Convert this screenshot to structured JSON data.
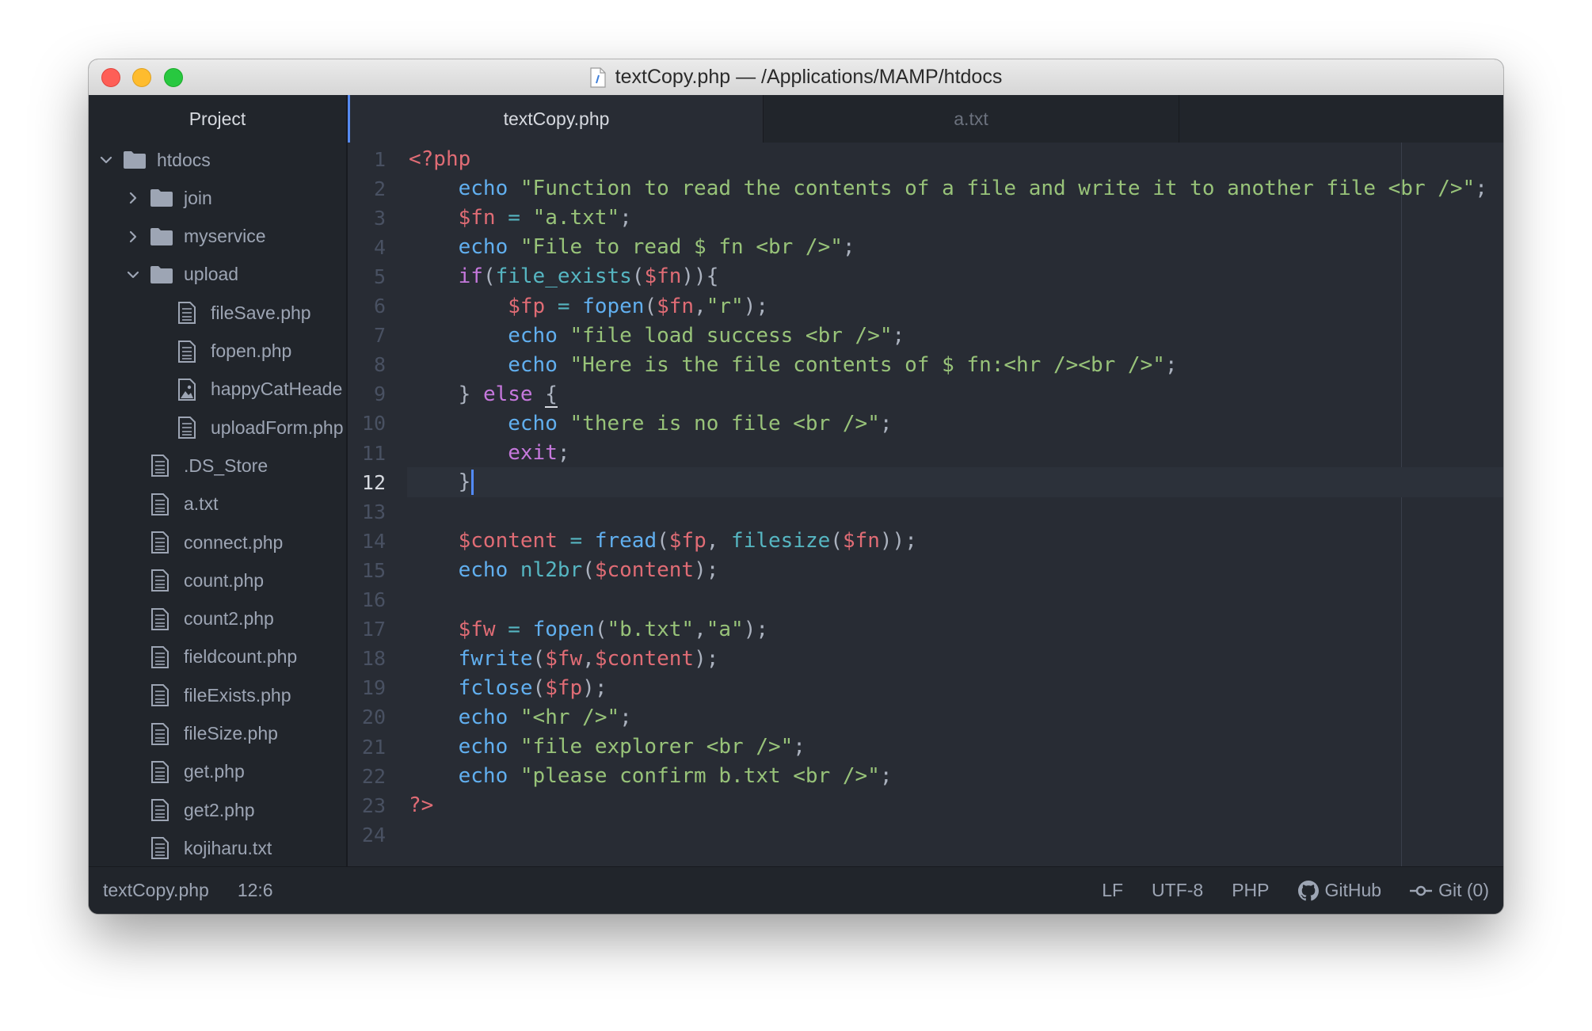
{
  "window": {
    "title": "textCopy.php — /Applications/MAMP/htdocs"
  },
  "sidebar": {
    "header": "Project",
    "tree": [
      {
        "label": "htdocs",
        "type": "folder",
        "expanded": true,
        "depth": 0
      },
      {
        "label": "join",
        "type": "folder",
        "expanded": false,
        "depth": 1
      },
      {
        "label": "myservice",
        "type": "folder",
        "expanded": false,
        "depth": 1
      },
      {
        "label": "upload",
        "type": "folder",
        "expanded": true,
        "depth": 1
      },
      {
        "label": "fileSave.php",
        "type": "file",
        "depth": 2
      },
      {
        "label": "fopen.php",
        "type": "file",
        "depth": 2
      },
      {
        "label": "happyCatHeade",
        "type": "image",
        "depth": 2
      },
      {
        "label": "uploadForm.php",
        "type": "file",
        "depth": 2
      },
      {
        "label": ".DS_Store",
        "type": "file",
        "depth": 1
      },
      {
        "label": "a.txt",
        "type": "file",
        "depth": 1
      },
      {
        "label": "connect.php",
        "type": "file",
        "depth": 1
      },
      {
        "label": "count.php",
        "type": "file",
        "depth": 1
      },
      {
        "label": "count2.php",
        "type": "file",
        "depth": 1
      },
      {
        "label": "fieldcount.php",
        "type": "file",
        "depth": 1
      },
      {
        "label": "fileExists.php",
        "type": "file",
        "depth": 1
      },
      {
        "label": "fileSize.php",
        "type": "file",
        "depth": 1
      },
      {
        "label": "get.php",
        "type": "file",
        "depth": 1
      },
      {
        "label": "get2.php",
        "type": "file",
        "depth": 1
      },
      {
        "label": "kojiharu.txt",
        "type": "file",
        "depth": 1
      }
    ]
  },
  "tabs": [
    {
      "label": "textCopy.php",
      "active": true
    },
    {
      "label": "a.txt",
      "active": false
    }
  ],
  "editor": {
    "active_line": 12,
    "lines": [
      [
        [
          "<?php",
          "#e06c75"
        ]
      ],
      [
        [
          "    ",
          ""
        ],
        [
          "echo",
          "#61afef"
        ],
        [
          " \"Function to read the contents of a file and write it to another file <br />\"",
          "#98c379"
        ],
        [
          ";",
          "#abb2bf"
        ]
      ],
      [
        [
          "    ",
          ""
        ],
        [
          "$fn",
          "#e06c75"
        ],
        [
          " = ",
          "#56b6c2"
        ],
        [
          "\"a.txt\"",
          "#98c379"
        ],
        [
          ";",
          "#abb2bf"
        ]
      ],
      [
        [
          "    ",
          ""
        ],
        [
          "echo",
          "#61afef"
        ],
        [
          " \"File to read $ fn <br />\"",
          "#98c379"
        ],
        [
          ";",
          "#abb2bf"
        ]
      ],
      [
        [
          "    ",
          ""
        ],
        [
          "if",
          "#c678dd"
        ],
        [
          "(",
          "#abb2bf"
        ],
        [
          "file_exists",
          "#56b6c2"
        ],
        [
          "(",
          "#abb2bf"
        ],
        [
          "$fn",
          "#e06c75"
        ],
        [
          "))",
          "#abb2bf"
        ],
        [
          "{",
          "#abb2bf"
        ]
      ],
      [
        [
          "        ",
          ""
        ],
        [
          "$fp",
          "#e06c75"
        ],
        [
          " = ",
          "#56b6c2"
        ],
        [
          "fopen",
          "#61afef"
        ],
        [
          "(",
          "#abb2bf"
        ],
        [
          "$fn",
          "#e06c75"
        ],
        [
          ",",
          "#abb2bf"
        ],
        [
          "\"r\"",
          "#98c379"
        ],
        [
          ");",
          "#abb2bf"
        ]
      ],
      [
        [
          "        ",
          ""
        ],
        [
          "echo",
          "#61afef"
        ],
        [
          " \"file load success <br />\"",
          "#98c379"
        ],
        [
          ";",
          "#abb2bf"
        ]
      ],
      [
        [
          "        ",
          ""
        ],
        [
          "echo",
          "#61afef"
        ],
        [
          " \"Here is the file contents of $ fn:<hr /><br />\"",
          "#98c379"
        ],
        [
          ";",
          "#abb2bf"
        ]
      ],
      [
        [
          "    ",
          ""
        ],
        [
          "} ",
          "#abb2bf"
        ],
        [
          "else",
          "#c678dd"
        ],
        [
          " {",
          "#abb2bf"
        ]
      ],
      [
        [
          "        ",
          ""
        ],
        [
          "echo",
          "#61afef"
        ],
        [
          " \"there is no file <br />\"",
          "#98c379"
        ],
        [
          ";",
          "#abb2bf"
        ]
      ],
      [
        [
          "        ",
          ""
        ],
        [
          "exit",
          "#c678dd"
        ],
        [
          ";",
          "#abb2bf"
        ]
      ],
      [
        [
          "    ",
          ""
        ],
        [
          "}",
          "#abb2bf"
        ]
      ],
      [],
      [
        [
          "    ",
          ""
        ],
        [
          "$content",
          "#e06c75"
        ],
        [
          " = ",
          "#56b6c2"
        ],
        [
          "fread",
          "#61afef"
        ],
        [
          "(",
          "#abb2bf"
        ],
        [
          "$fp",
          "#e06c75"
        ],
        [
          ", ",
          "#abb2bf"
        ],
        [
          "filesize",
          "#56b6c2"
        ],
        [
          "(",
          "#abb2bf"
        ],
        [
          "$fn",
          "#e06c75"
        ],
        [
          "));",
          "#abb2bf"
        ]
      ],
      [
        [
          "    ",
          ""
        ],
        [
          "echo",
          "#61afef"
        ],
        [
          " ",
          "#abb2bf"
        ],
        [
          "nl2br",
          "#56b6c2"
        ],
        [
          "(",
          "#abb2bf"
        ],
        [
          "$content",
          "#e06c75"
        ],
        [
          ");",
          "#abb2bf"
        ]
      ],
      [],
      [
        [
          "    ",
          ""
        ],
        [
          "$fw",
          "#e06c75"
        ],
        [
          " = ",
          "#56b6c2"
        ],
        [
          "fopen",
          "#61afef"
        ],
        [
          "(",
          "#abb2bf"
        ],
        [
          "\"b.txt\"",
          "#98c379"
        ],
        [
          ",",
          "#abb2bf"
        ],
        [
          "\"a\"",
          "#98c379"
        ],
        [
          ");",
          "#abb2bf"
        ]
      ],
      [
        [
          "    ",
          ""
        ],
        [
          "fwrite",
          "#61afef"
        ],
        [
          "(",
          "#abb2bf"
        ],
        [
          "$fw",
          "#e06c75"
        ],
        [
          ",",
          "#abb2bf"
        ],
        [
          "$content",
          "#e06c75"
        ],
        [
          ");",
          "#abb2bf"
        ]
      ],
      [
        [
          "    ",
          ""
        ],
        [
          "fclose",
          "#61afef"
        ],
        [
          "(",
          "#abb2bf"
        ],
        [
          "$fp",
          "#e06c75"
        ],
        [
          ");",
          "#abb2bf"
        ]
      ],
      [
        [
          "    ",
          ""
        ],
        [
          "echo",
          "#61afef"
        ],
        [
          " \"<hr />\"",
          "#98c379"
        ],
        [
          ";",
          "#abb2bf"
        ]
      ],
      [
        [
          "    ",
          ""
        ],
        [
          "echo",
          "#61afef"
        ],
        [
          " \"file explorer <br />\"",
          "#98c379"
        ],
        [
          ";",
          "#abb2bf"
        ]
      ],
      [
        [
          "    ",
          ""
        ],
        [
          "echo",
          "#61afef"
        ],
        [
          " \"please confirm b.txt <br />\"",
          "#98c379"
        ],
        [
          ";",
          "#abb2bf"
        ]
      ],
      [
        [
          "?>",
          "#e06c75"
        ]
      ],
      []
    ]
  },
  "statusbar": {
    "filename": "textCopy.php",
    "cursor_position": "12:6",
    "line_ending": "LF",
    "encoding": "UTF-8",
    "grammar": "PHP",
    "github_label": "GitHub",
    "git_label": "Git (0)"
  },
  "colors": {
    "accent": "#568af2",
    "background": "#282c34",
    "panel": "#21252b"
  }
}
